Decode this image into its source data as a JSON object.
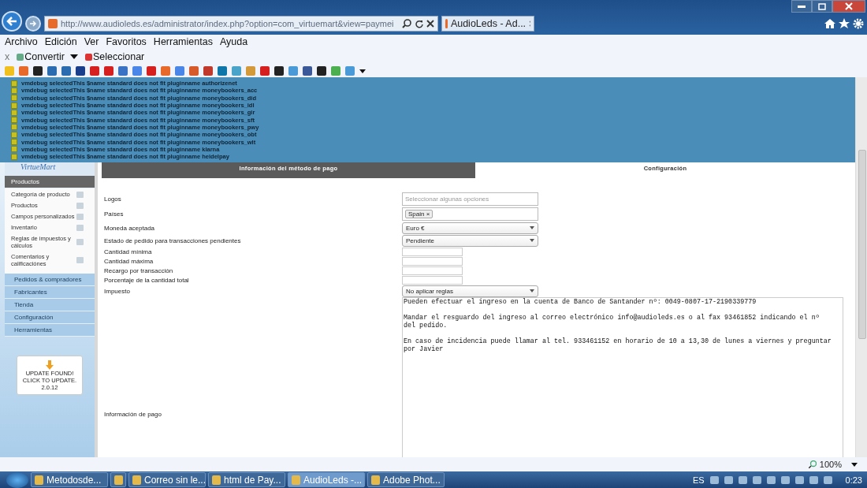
{
  "browser": {
    "address": "http://www.audioleds.es/administrator/index.php?option=com_virtuemart&view=paymei",
    "tab_title": "AudioLeds - Ad...",
    "menu": [
      "Archivo",
      "Edición",
      "Ver",
      "Favoritos",
      "Herramientas",
      "Ayuda"
    ],
    "command_close": "x",
    "commands": [
      "Convertir",
      "Seleccionar"
    ]
  },
  "debug_messages": [
    "vmdebug selectedThis $name standard does not fit pluginname authorizenet",
    "vmdebug selectedThis $name standard does not fit pluginname moneybookers_acc",
    "vmdebug selectedThis $name standard does not fit pluginname moneybookers_did",
    "vmdebug selectedThis $name standard does not fit pluginname moneybookers_idl",
    "vmdebug selectedThis $name standard does not fit pluginname moneybookers_gir",
    "vmdebug selectedThis $name standard does not fit pluginname moneybookers_sft",
    "vmdebug selectedThis $name standard does not fit pluginname moneybookers_pwy",
    "vmdebug selectedThis $name standard does not fit pluginname moneybookers_obt",
    "vmdebug selectedThis $name standard does not fit pluginname moneybookers_wlt",
    "vmdebug selectedThis $name standard does not fit pluginname klarna",
    "vmdebug selectedThis $name standard does not fit pluginname heidelpay"
  ],
  "sidebar": {
    "logo": "VirtueMart",
    "sections": [
      {
        "label": "Productos",
        "expanded": true,
        "items": [
          "Categoría de producto",
          "Productos",
          "Campos personalizados",
          "Inventario",
          "Reglas de impuestos y cálculos",
          "Comentarios y calificaciónes"
        ]
      },
      {
        "label": "Pedidos & compradores",
        "expanded": false
      },
      {
        "label": "Fabricantes",
        "expanded": false
      },
      {
        "label": "Tienda",
        "expanded": false
      },
      {
        "label": "Configuración",
        "expanded": false
      },
      {
        "label": "Herramientas",
        "expanded": false
      }
    ],
    "update_badge": [
      "UPDATE FOUND!",
      "CLICK TO UPDATE.",
      "2.0.12"
    ]
  },
  "tabs": [
    {
      "label": "Información del método de pago",
      "selected": true
    },
    {
      "label": "Configuración",
      "selected": false
    }
  ],
  "fields": [
    {
      "label": "Logos",
      "kind": "multiselect",
      "placeholder": "Seleccionar algunas opciones"
    },
    {
      "label": "Países",
      "kind": "tags",
      "tags": [
        "Spain"
      ],
      "remove": "×"
    },
    {
      "label": "Moneda aceptada",
      "kind": "select",
      "value": "Euro €"
    },
    {
      "label": "Estado de pedido para transacciones pendientes",
      "kind": "select",
      "value": "Pendiente"
    },
    {
      "label": "Cantidad mínima",
      "kind": "text"
    },
    {
      "label": "Cantidad máxima",
      "kind": "text"
    },
    {
      "label": "Recargo por transacción",
      "kind": "text"
    },
    {
      "label": "Porcentaje de la cantidad total",
      "kind": "text"
    },
    {
      "label": "Impuesto",
      "kind": "select",
      "value": "No aplicar reglas"
    },
    {
      "label": "Información de pago",
      "kind": "textarea",
      "value": "Pueden efectuar el ingreso en la cuenta de Banco de Santander nº: 0049-0807-17-2190339779\n\nMandar el resguardo del ingreso al correo electrónico info@audioleds.es o al fax 93461852 indicando el nº del pedido.\n\nEn caso de incidencia puede llamar al tel. 933461152 en horario de 10 a 13,30 de lunes a viernes y preguntar por Javier"
    }
  ],
  "status_bar": {
    "zoom": "100%"
  },
  "taskbar": {
    "items": [
      {
        "label": "Metodosde...",
        "active": false
      },
      {
        "active": false
      },
      {
        "label": "Correo sin le...",
        "active": false
      },
      {
        "label": "html de Pay...",
        "active": false
      },
      {
        "label": "AudioLeds -...",
        "active": true
      },
      {
        "label": "Adobe Phot...",
        "active": false
      }
    ],
    "language": "ES",
    "clock": "0:23"
  }
}
